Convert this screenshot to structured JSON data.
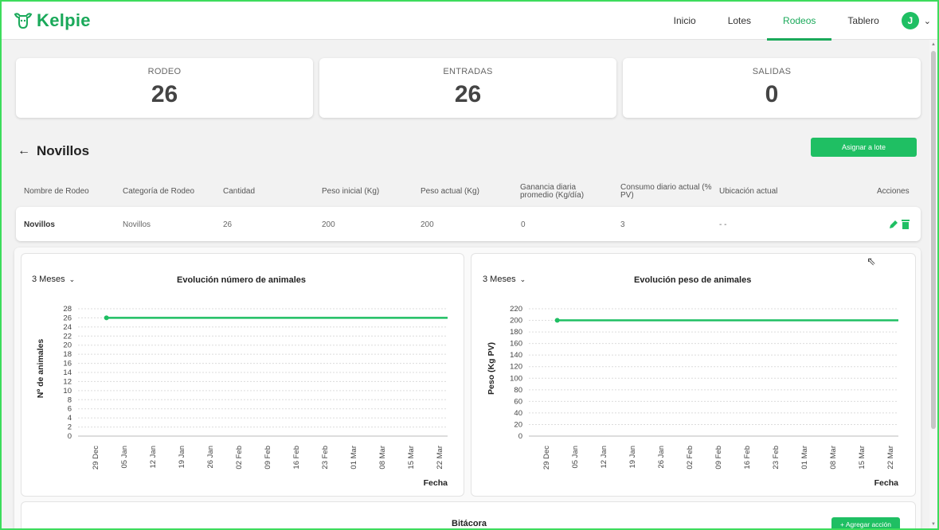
{
  "app": {
    "brand": "Kelpie",
    "nav": [
      {
        "label": "Inicio",
        "active": false
      },
      {
        "label": "Lotes",
        "active": false
      },
      {
        "label": "Rodeos",
        "active": true
      },
      {
        "label": "Tablero",
        "active": false
      }
    ],
    "user_initial": "J",
    "accent_color": "#1fbf63"
  },
  "stats": [
    {
      "label": "RODEO",
      "value": "26"
    },
    {
      "label": "ENTRADAS",
      "value": "26"
    },
    {
      "label": "SALIDAS",
      "value": "0"
    }
  ],
  "section": {
    "title": "Novillos",
    "assign_button": "Asignar a lote"
  },
  "table": {
    "headers": [
      "Nombre de Rodeo",
      "Categoría de Rodeo",
      "Cantidad",
      "Peso inicial (Kg)",
      "Peso actual (Kg)",
      "Ganancia diaria promedio (Kg/día)",
      "Consumo diario actual (% PV)",
      "Ubicación actual",
      "Acciones"
    ],
    "rows": [
      [
        "Novillos",
        "Novillos",
        "26",
        "200",
        "200",
        "0",
        "3",
        "- -"
      ]
    ]
  },
  "charts": {
    "left": {
      "range": "3 Meses",
      "title": "Evolución número de animales",
      "ylabel": "Nº de animales",
      "xlabel": "Fecha"
    },
    "right": {
      "range": "3 Meses",
      "title": "Evolución peso de animales",
      "ylabel": "Peso (Kg PV)",
      "xlabel": "Fecha"
    }
  },
  "chart_data": [
    {
      "type": "line",
      "title": "Evolución número de animales",
      "xlabel": "Fecha",
      "ylabel": "Nº de animales",
      "categories": [
        "29 Dec",
        "05 Jan",
        "12 Jan",
        "19 Jan",
        "26 Jan",
        "02 Feb",
        "09 Feb",
        "16 Feb",
        "23 Feb",
        "01 Mar",
        "08 Mar",
        "15 Mar",
        "22 Mar"
      ],
      "yticks": [
        0,
        2,
        4,
        6,
        8,
        10,
        12,
        14,
        16,
        18,
        20,
        22,
        24,
        26,
        28
      ],
      "ylim": [
        0,
        28
      ],
      "series": [
        {
          "x": [
            "2022-01-01",
            "2022-03-24"
          ],
          "values": [
            26,
            26
          ]
        }
      ],
      "color": "#1fbf63",
      "grid": true
    },
    {
      "type": "line",
      "title": "Evolución peso de animales",
      "xlabel": "Fecha",
      "ylabel": "Peso (Kg PV)",
      "categories": [
        "29 Dec",
        "05 Jan",
        "12 Jan",
        "19 Jan",
        "26 Jan",
        "02 Feb",
        "09 Feb",
        "16 Feb",
        "23 Feb",
        "01 Mar",
        "08 Mar",
        "15 Mar",
        "22 Mar"
      ],
      "yticks": [
        0,
        20,
        40,
        60,
        80,
        100,
        120,
        140,
        160,
        180,
        200,
        220
      ],
      "ylim": [
        0,
        220
      ],
      "series": [
        {
          "x": [
            "2022-01-01",
            "2022-03-24"
          ],
          "values": [
            200,
            200
          ]
        }
      ],
      "color": "#1fbf63",
      "grid": true
    }
  ],
  "bitacora": {
    "title": "Bitácora",
    "add_button": "+ Agregar acción"
  }
}
